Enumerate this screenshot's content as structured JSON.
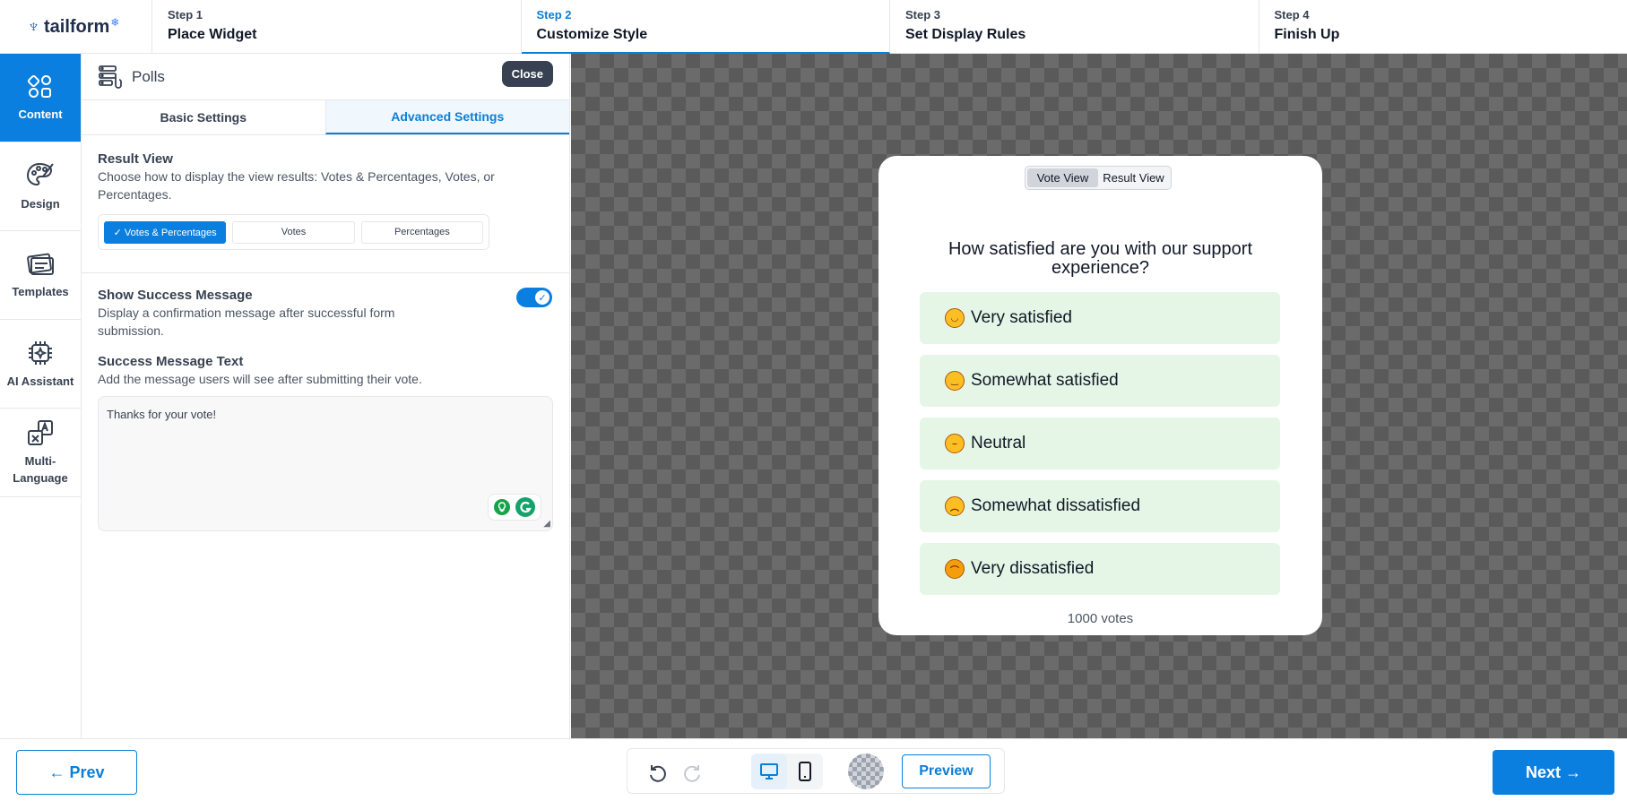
{
  "header": {
    "brand": "tailform",
    "steps": [
      {
        "num": "Step 1",
        "name": "Place Widget",
        "active": false
      },
      {
        "num": "Step 2",
        "name": "Customize Style",
        "active": true
      },
      {
        "num": "Step 3",
        "name": "Set Display Rules",
        "active": false
      },
      {
        "num": "Step 4",
        "name": "Finish Up",
        "active": false
      }
    ]
  },
  "rail": {
    "items": [
      {
        "label": "Content",
        "icon": "grid-shapes-icon",
        "active": true
      },
      {
        "label": "Design",
        "icon": "palette-icon",
        "active": false
      },
      {
        "label": "Templates",
        "icon": "templates-icon",
        "active": false
      },
      {
        "label": "AI Assistant",
        "icon": "chip-sparkle-icon",
        "active": false
      },
      {
        "label": "Multi-Language",
        "icon": "translate-icon",
        "active": false
      }
    ]
  },
  "panel": {
    "title": "Polls",
    "close_label": "Close",
    "tabs": [
      {
        "label": "Basic Settings",
        "active": false
      },
      {
        "label": "Advanced Settings",
        "active": true
      }
    ],
    "result_view": {
      "label": "Result View",
      "description": "Choose how to display the view results: Votes & Percentages, Votes, or Percentages.",
      "options": [
        "✓ Votes & Percentages",
        "Votes",
        "Percentages"
      ],
      "selected": "Votes & Percentages"
    },
    "success_message": {
      "label": "Show Success Message",
      "description": "Display a confirmation message after successful form submission.",
      "enabled": true
    },
    "success_text": {
      "label": "Success Message Text",
      "description": "Add the message users will see after submitting their vote.",
      "value": "Thanks for your vote!"
    }
  },
  "poll": {
    "view_tabs": [
      "Vote View",
      "Result View"
    ],
    "active_view": "Vote View",
    "question": "How satisfied are you with our support experience?",
    "options": [
      {
        "label": "Very satisfied",
        "icon": "smiling-face-icon",
        "face": "◡"
      },
      {
        "label": "Somewhat satisfied",
        "icon": "slight-smile-icon",
        "face": "‿"
      },
      {
        "label": "Neutral",
        "icon": "neutral-face-icon",
        "face": "–"
      },
      {
        "label": "Somewhat dissatisfied",
        "icon": "slight-frown-icon",
        "face": "︵"
      },
      {
        "label": "Very dissatisfied",
        "icon": "angry-face-icon",
        "face": "⌒"
      }
    ],
    "votes_text": "1000 votes"
  },
  "footer": {
    "prev_label": "← Prev",
    "next_label": "Next →",
    "preview_label": "Preview"
  },
  "colors": {
    "accent": "#0b7fe0",
    "option_bg": "#e5f6e6"
  }
}
